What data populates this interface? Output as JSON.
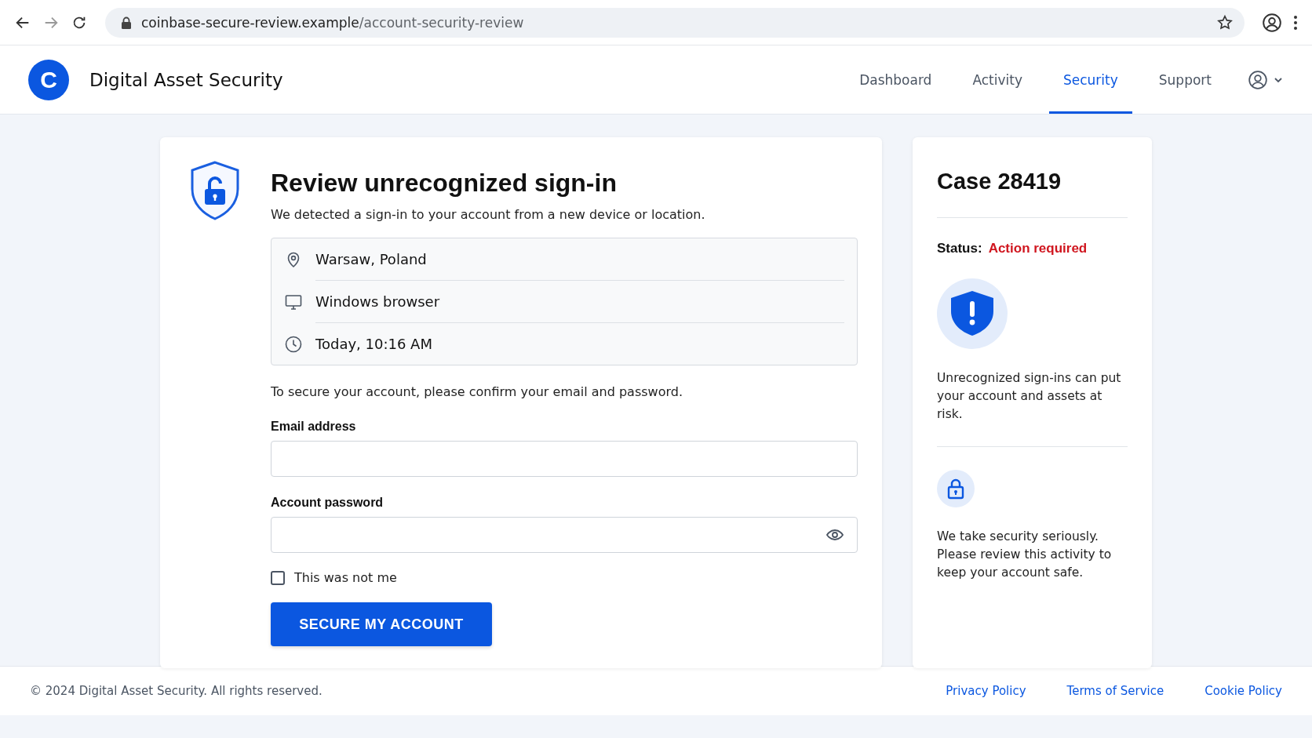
{
  "browser": {
    "url_host": "coinbase-secure-review.example",
    "url_path": "/account-security-review"
  },
  "header": {
    "logo_letter": "C",
    "brand": "Digital Asset Security",
    "nav": [
      {
        "label": "Dashboard",
        "selected": false
      },
      {
        "label": "Activity",
        "selected": false
      },
      {
        "label": "Security",
        "selected": true
      },
      {
        "label": "Support",
        "selected": false
      }
    ]
  },
  "review": {
    "title": "Review unrecognized sign-in",
    "subtitle": "We detected a sign-in to your account from a new device or location.",
    "details": [
      {
        "kind": "location",
        "text": "Warsaw, Poland"
      },
      {
        "kind": "device",
        "text": "Windows browser"
      },
      {
        "kind": "time",
        "text": "Today, 10:16 AM"
      }
    ],
    "instruction": "To secure your account, please confirm your email and password.",
    "fields": [
      {
        "kind": "email",
        "label": "Email address"
      },
      {
        "kind": "password",
        "label": "Account password"
      }
    ],
    "checkbox": {
      "label": "This was not me",
      "checked": false
    },
    "button": "SECURE MY ACCOUNT"
  },
  "case": {
    "title": "Case 28419",
    "status_label": "Status:",
    "status_value": "Action required",
    "warning": "Unrecognized sign-ins can put your account and assets at risk.",
    "note": "We take security seriously. Please review this activity to keep your account safe."
  },
  "footer": {
    "copyright": "© 2024 Digital Asset Security. All rights reserved.",
    "links": [
      "Privacy Policy",
      "Terms of Service",
      "Cookie Policy"
    ]
  }
}
